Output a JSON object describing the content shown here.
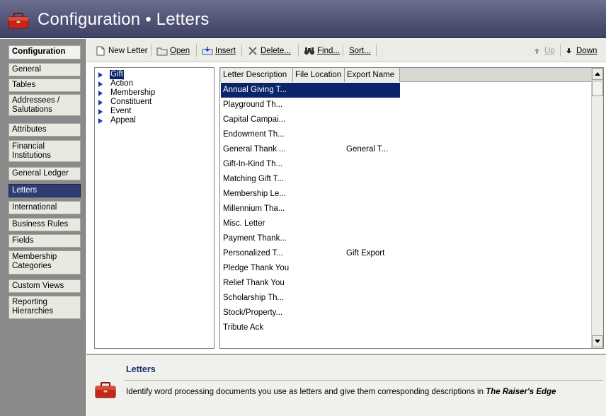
{
  "window": {
    "title": "Configuration • Letters"
  },
  "nav": {
    "items": [
      {
        "label": "Configuration",
        "header": true
      },
      {
        "label": "General"
      },
      {
        "label": "Tables"
      },
      {
        "label": "Addressees / Salutations"
      },
      {
        "label": "Attributes"
      },
      {
        "label": "Financial Institutions"
      },
      {
        "label": "General Ledger"
      },
      {
        "label": "Letters",
        "selected": true
      },
      {
        "label": "International"
      },
      {
        "label": "Business Rules"
      },
      {
        "label": "Fields"
      },
      {
        "label": "Membership Categories"
      },
      {
        "label": "Custom Views"
      },
      {
        "label": "Reporting Hierarchies"
      }
    ]
  },
  "toolbar": {
    "new_letter": "New Letter",
    "open": "Open",
    "insert": "Insert",
    "delete": "Delete...",
    "find": "Find...",
    "sort": "Sort...",
    "up": "Up",
    "down": "Down"
  },
  "tree": {
    "items": [
      "Gift",
      "Action",
      "Membership",
      "Constituent",
      "Event",
      "Appeal"
    ],
    "selected": "Gift"
  },
  "grid": {
    "columns": [
      "Letter Description",
      "File Location",
      "Export Name"
    ],
    "rows": [
      {
        "desc": "Annual Giving T...",
        "loc": "",
        "export": ""
      },
      {
        "desc": "Playground Th...",
        "loc": "",
        "export": ""
      },
      {
        "desc": "Capital Campai...",
        "loc": "",
        "export": ""
      },
      {
        "desc": "Endowment Th...",
        "loc": "",
        "export": ""
      },
      {
        "desc": "General Thank ...",
        "loc": "",
        "export": "General T..."
      },
      {
        "desc": "Gift-In-Kind Th...",
        "loc": "",
        "export": ""
      },
      {
        "desc": "Matching Gift T...",
        "loc": "",
        "export": ""
      },
      {
        "desc": "Membership Le...",
        "loc": "",
        "export": ""
      },
      {
        "desc": "Millennium Tha...",
        "loc": "",
        "export": ""
      },
      {
        "desc": "Misc. Letter",
        "loc": "",
        "export": ""
      },
      {
        "desc": "Payment Thank...",
        "loc": "",
        "export": ""
      },
      {
        "desc": "Personalized T...",
        "loc": "",
        "export": "Gift Export"
      },
      {
        "desc": "Pledge Thank You",
        "loc": "",
        "export": ""
      },
      {
        "desc": "Relief Thank You",
        "loc": "",
        "export": ""
      },
      {
        "desc": "Scholarship Th...",
        "loc": "",
        "export": ""
      },
      {
        "desc": "Stock/Property...",
        "loc": "",
        "export": ""
      },
      {
        "desc": "Tribute Ack",
        "loc": "",
        "export": ""
      }
    ]
  },
  "info": {
    "title": "Letters",
    "text": "Identify word processing documents you use as letters and give them corresponding descriptions in",
    "product": "The Raiser's Edge"
  },
  "colors": {
    "titlebar": "#55587a",
    "selection": "#0a246a",
    "nav_selected": "#2f3d73",
    "toolbox_red": "#c8241c"
  }
}
